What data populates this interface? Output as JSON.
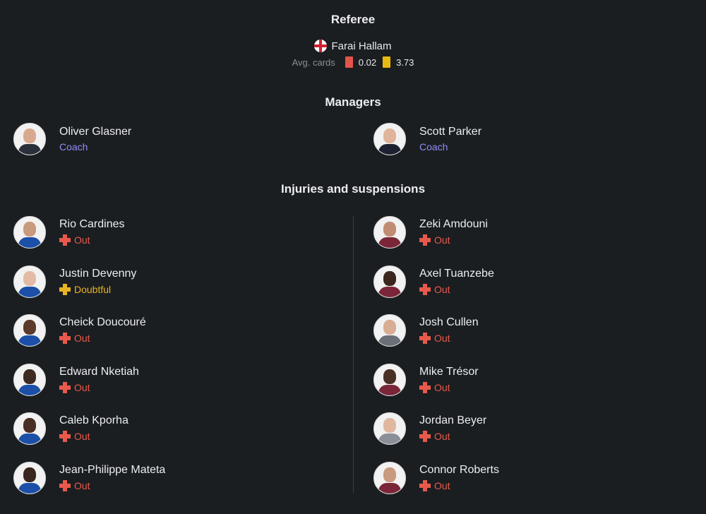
{
  "referee": {
    "section_title": "Referee",
    "name": "Farai Hallam",
    "flag_icon": "england-flag-icon",
    "avg_cards_label": "Avg. cards",
    "red_avg": "0.02",
    "yellow_avg": "3.73"
  },
  "managers": {
    "section_title": "Managers",
    "home": {
      "name": "Oliver Glasner",
      "role": "Coach"
    },
    "away": {
      "name": "Scott Parker",
      "role": "Coach"
    }
  },
  "injuries": {
    "section_title": "Injuries and suspensions",
    "home": [
      {
        "name": "Rio Cardines",
        "status": "Out"
      },
      {
        "name": "Justin Devenny",
        "status": "Doubtful"
      },
      {
        "name": "Cheick Doucouré",
        "status": "Out"
      },
      {
        "name": "Edward Nketiah",
        "status": "Out"
      },
      {
        "name": "Caleb Kporha",
        "status": "Out"
      },
      {
        "name": "Jean-Philippe Mateta",
        "status": "Out"
      }
    ],
    "away": [
      {
        "name": "Zeki Amdouni",
        "status": "Out"
      },
      {
        "name": "Axel Tuanzebe",
        "status": "Out"
      },
      {
        "name": "Josh Cullen",
        "status": "Out"
      },
      {
        "name": "Mike Trésor",
        "status": "Out"
      },
      {
        "name": "Jordan Beyer",
        "status": "Out"
      },
      {
        "name": "Connor Roberts",
        "status": "Out"
      }
    ]
  },
  "colors": {
    "background": "#1b1e21",
    "out": "#e8594c",
    "doubtful": "#e8b423",
    "coach": "#8f8cf6",
    "red_card": "#e2544b",
    "yellow_card": "#e9b913"
  }
}
